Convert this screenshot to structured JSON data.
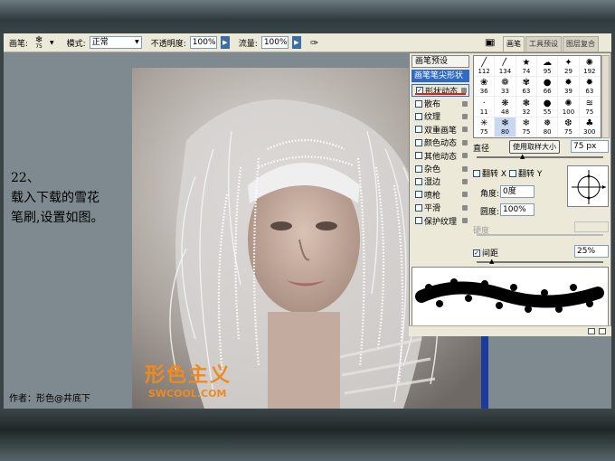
{
  "options_bar": {
    "brush_label": "画笔:",
    "brush_size": "75",
    "mode_label": "模式:",
    "mode_value": "正常",
    "opacity_label": "不透明度:",
    "opacity_value": "100%",
    "flow_label": "流量:",
    "flow_value": "100%"
  },
  "panel_tabs": [
    "画笔",
    "工具预设",
    "图层复合"
  ],
  "brush_panel": {
    "preset_button": "画笔预设",
    "tip_shape": "画笔笔尖形状",
    "options": [
      {
        "label": "形状动态",
        "checked": true
      },
      {
        "label": "散布",
        "checked": false
      },
      {
        "label": "纹理",
        "checked": false
      },
      {
        "label": "双重画笔",
        "checked": false
      },
      {
        "label": "颜色动态",
        "checked": false
      },
      {
        "label": "其他动态",
        "checked": false
      },
      {
        "label": "杂色",
        "checked": false
      },
      {
        "label": "湿边",
        "checked": false
      },
      {
        "label": "喷枪",
        "checked": false
      },
      {
        "label": "平滑",
        "checked": false
      },
      {
        "label": "保护纹理",
        "checked": false
      }
    ],
    "brushes": [
      {
        "size": "112",
        "glyph": "╱"
      },
      {
        "size": "134",
        "glyph": "〳"
      },
      {
        "size": "74",
        "glyph": "★"
      },
      {
        "size": "95",
        "glyph": "☁"
      },
      {
        "size": "29",
        "glyph": "✦"
      },
      {
        "size": "192",
        "glyph": "✺"
      },
      {
        "size": "36",
        "glyph": "❀"
      },
      {
        "size": "33",
        "glyph": "❁"
      },
      {
        "size": "63",
        "glyph": "✾"
      },
      {
        "size": "66",
        "glyph": "●"
      },
      {
        "size": "39",
        "glyph": "✹"
      },
      {
        "size": "63",
        "glyph": "✹"
      },
      {
        "size": "11",
        "glyph": "·"
      },
      {
        "size": "48",
        "glyph": "❋"
      },
      {
        "size": "32",
        "glyph": "❃"
      },
      {
        "size": "55",
        "glyph": "●"
      },
      {
        "size": "100",
        "glyph": "✺"
      },
      {
        "size": "75",
        "glyph": "≋"
      },
      {
        "size": "75",
        "glyph": "✳"
      },
      {
        "size": "80",
        "glyph": "❄"
      },
      {
        "size": "75",
        "glyph": "❄"
      },
      {
        "size": "80",
        "glyph": "❅"
      },
      {
        "size": "75",
        "glyph": "❆"
      },
      {
        "size": "300",
        "glyph": "♣"
      }
    ],
    "selected_brush": 19,
    "diameter_label": "直径",
    "use_sample_size": "使用取样大小",
    "diameter_value": "75 px",
    "flip_x": "翻转 X",
    "flip_y": "翻转 Y",
    "angle_label": "角度:",
    "angle_value": "0度",
    "roundness_label": "圆度:",
    "roundness_value": "100%",
    "hardness_label": "硬度",
    "spacing_label": "间距",
    "spacing_value": "25%",
    "spacing_checked": true
  },
  "tutorial": {
    "step": "22、",
    "line1": "载入下载的雪花",
    "line2": "笔刷,设置如图。"
  },
  "credit": "作者：形色@井底下",
  "watermark": {
    "main": "形色主义",
    "sub": "SWCOOL.COM"
  }
}
